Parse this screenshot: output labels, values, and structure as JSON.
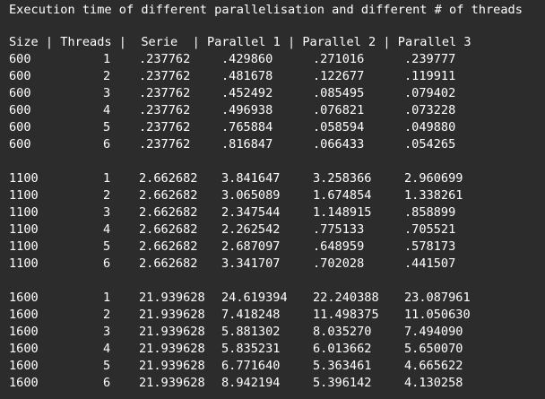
{
  "title": "Execution time of different parallelisation and different # of threads",
  "header": "Size | Threads |  Serie  | Parallel 1 | Parallel 2 | Parallel 3",
  "groups": [
    {
      "rows": [
        {
          "size": "600",
          "threads": "1",
          "serie": ".237762",
          "p1": ".429860",
          "p2": ".271016",
          "p3": ".239777"
        },
        {
          "size": "600",
          "threads": "2",
          "serie": ".237762",
          "p1": ".481678",
          "p2": ".122677",
          "p3": ".119911"
        },
        {
          "size": "600",
          "threads": "3",
          "serie": ".237762",
          "p1": ".452492",
          "p2": ".085495",
          "p3": ".079402"
        },
        {
          "size": "600",
          "threads": "4",
          "serie": ".237762",
          "p1": ".496938",
          "p2": ".076821",
          "p3": ".073228"
        },
        {
          "size": "600",
          "threads": "5",
          "serie": ".237762",
          "p1": ".765884",
          "p2": ".058594",
          "p3": ".049880"
        },
        {
          "size": "600",
          "threads": "6",
          "serie": ".237762",
          "p1": ".816847",
          "p2": ".066433",
          "p3": ".054265"
        }
      ]
    },
    {
      "rows": [
        {
          "size": "1100",
          "threads": "1",
          "serie": "2.662682",
          "p1": "3.841647",
          "p2": "3.258366",
          "p3": "2.960699"
        },
        {
          "size": "1100",
          "threads": "2",
          "serie": "2.662682",
          "p1": "3.065089",
          "p2": "1.674854",
          "p3": "1.338261"
        },
        {
          "size": "1100",
          "threads": "3",
          "serie": "2.662682",
          "p1": "2.347544",
          "p2": "1.148915",
          "p3": ".858899"
        },
        {
          "size": "1100",
          "threads": "4",
          "serie": "2.662682",
          "p1": "2.262542",
          "p2": ".775133",
          "p3": ".705521"
        },
        {
          "size": "1100",
          "threads": "5",
          "serie": "2.662682",
          "p1": "2.687097",
          "p2": ".648959",
          "p3": ".578173"
        },
        {
          "size": "1100",
          "threads": "6",
          "serie": "2.662682",
          "p1": "3.341707",
          "p2": ".702028",
          "p3": ".441507"
        }
      ]
    },
    {
      "rows": [
        {
          "size": "1600",
          "threads": "1",
          "serie": "21.939628",
          "p1": "24.619394",
          "p2": "22.240388",
          "p3": "23.087961"
        },
        {
          "size": "1600",
          "threads": "2",
          "serie": "21.939628",
          "p1": "7.418248",
          "p2": "11.498375",
          "p3": "11.050630"
        },
        {
          "size": "1600",
          "threads": "3",
          "serie": "21.939628",
          "p1": "5.881302",
          "p2": "8.035270",
          "p3": "7.494090"
        },
        {
          "size": "1600",
          "threads": "4",
          "serie": "21.939628",
          "p1": "5.835231",
          "p2": "6.013662",
          "p3": "5.650070"
        },
        {
          "size": "1600",
          "threads": "5",
          "serie": "21.939628",
          "p1": "6.771640",
          "p2": "5.363461",
          "p3": "4.665622"
        },
        {
          "size": "1600",
          "threads": "6",
          "serie": "21.939628",
          "p1": "8.942194",
          "p2": "5.396142",
          "p3": "4.130258"
        }
      ]
    }
  ],
  "colors": {
    "background": "#2c2c2c",
    "text": "#ffffff"
  }
}
